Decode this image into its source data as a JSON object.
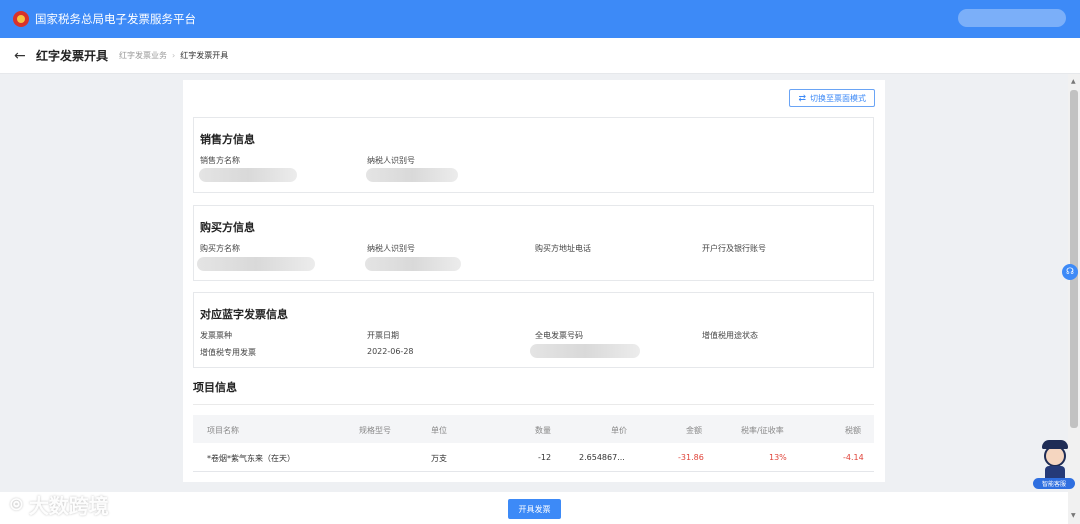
{
  "header": {
    "app_title": "国家税务总局电子发票服务平台"
  },
  "breadcrumb": {
    "page_title": "红字发票开具",
    "parent": "红字发票业务",
    "separator": "›",
    "current": "红字发票开具"
  },
  "toolbar": {
    "switch_mode_label": "切换至票面模式"
  },
  "seller": {
    "title": "销售方信息",
    "name_label": "销售方名称",
    "tax_id_label": "纳税人识别号"
  },
  "buyer": {
    "title": "购买方信息",
    "name_label": "购买方名称",
    "tax_id_label": "纳税人识别号",
    "address_phone_label": "购买方地址电话",
    "bank_account_label": "开户行及银行账号"
  },
  "blue_invoice": {
    "title": "对应蓝字发票信息",
    "type_label": "发票票种",
    "type_value": "增值税专用发票",
    "date_label": "开票日期",
    "date_value": "2022-06-28",
    "number_label": "全电发票号码",
    "vat_status_label": "增值税用途状态"
  },
  "items": {
    "title": "项目信息",
    "columns": [
      "项目名称",
      "规格型号",
      "单位",
      "数量",
      "单价",
      "金额",
      "税率/征收率",
      "税额"
    ],
    "rows": [
      {
        "name": "*卷烟*紫气东来（在天）",
        "spec": "",
        "unit": "万支",
        "qty": "-12",
        "price": "2.654867...",
        "amount": "-31.86",
        "rate": "13%",
        "tax": "-4.14"
      }
    ]
  },
  "footer": {
    "submit_label": "开具发票"
  },
  "assistant": {
    "label": "智能客服"
  },
  "watermark": {
    "text": "大数跨境"
  },
  "colors": {
    "primary": "#3d8af7",
    "negative": "#e0443a"
  }
}
